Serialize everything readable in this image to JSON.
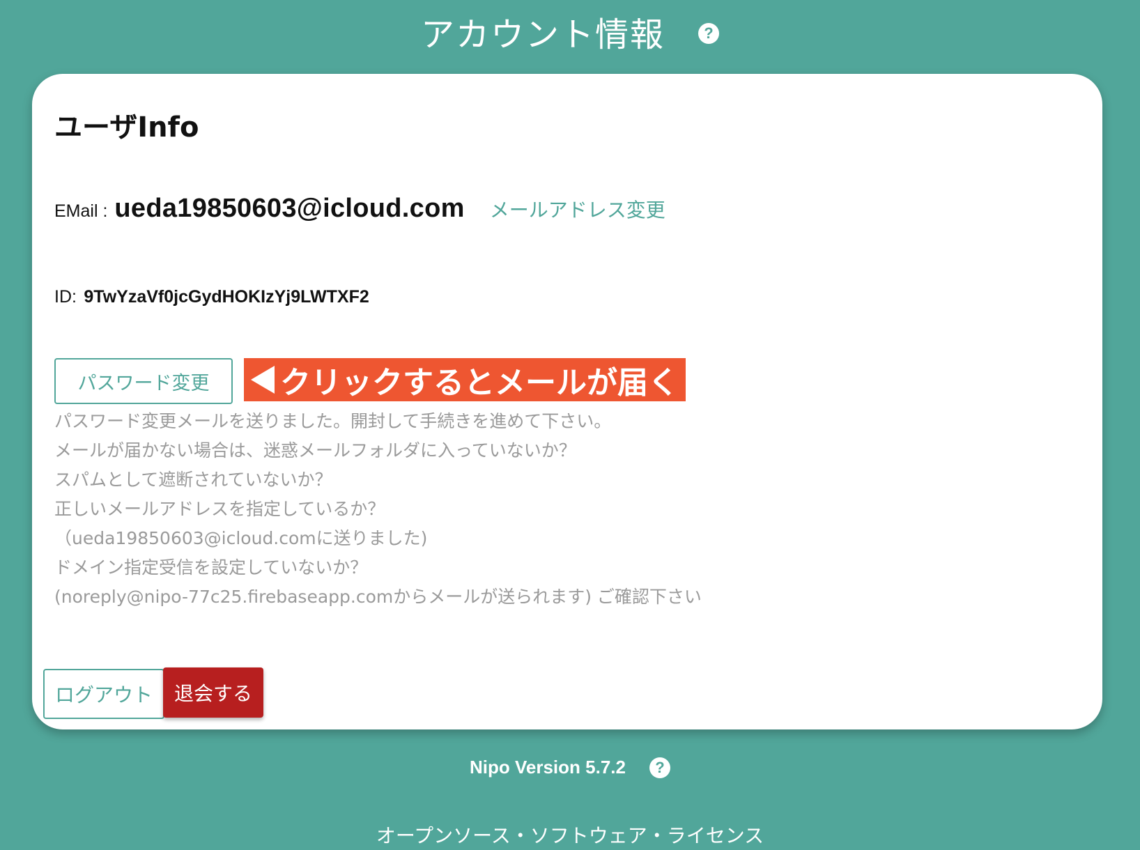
{
  "header": {
    "title": "アカウント情報",
    "help_icon": "?"
  },
  "card": {
    "title": "ユーザInfo",
    "email": {
      "label": "EMail :",
      "value": "ueda19850603@icloud.com",
      "change_link": "メールアドレス変更"
    },
    "id": {
      "label": "ID:",
      "value": "9TwYzaVf0jcGydHOKIzYj9LWTXF2"
    },
    "password_button": "パスワード変更",
    "annotation": "クリックするとメールが届く",
    "notice_lines": [
      "パスワード変更メールを送りました。開封して手続きを進めて下さい。",
      "メールが届かない場合は、迷惑メールフォルダに入っていないか？",
      "スパムとして遮断されていないか？",
      "正しいメールアドレスを指定しているか？",
      "（ueda19850603@icloud.comに送りました)",
      "ドメイン指定受信を設定していないか？",
      "(noreply@nipo-77c25.firebaseapp.comからメールが送られます) ご確認下さい"
    ],
    "logout_button": "ログアウト",
    "withdraw_button": "退会する"
  },
  "footer": {
    "version": "Nipo Version 5.7.2",
    "help_icon": "?",
    "oss_link": "オープンソース・ソフトウェア・ライセンス"
  },
  "colors": {
    "background": "#51a69a",
    "accent": "#51a69a",
    "annotation": "#ee5631",
    "danger": "#b71f1f",
    "notice_text": "#9a9a9a"
  }
}
